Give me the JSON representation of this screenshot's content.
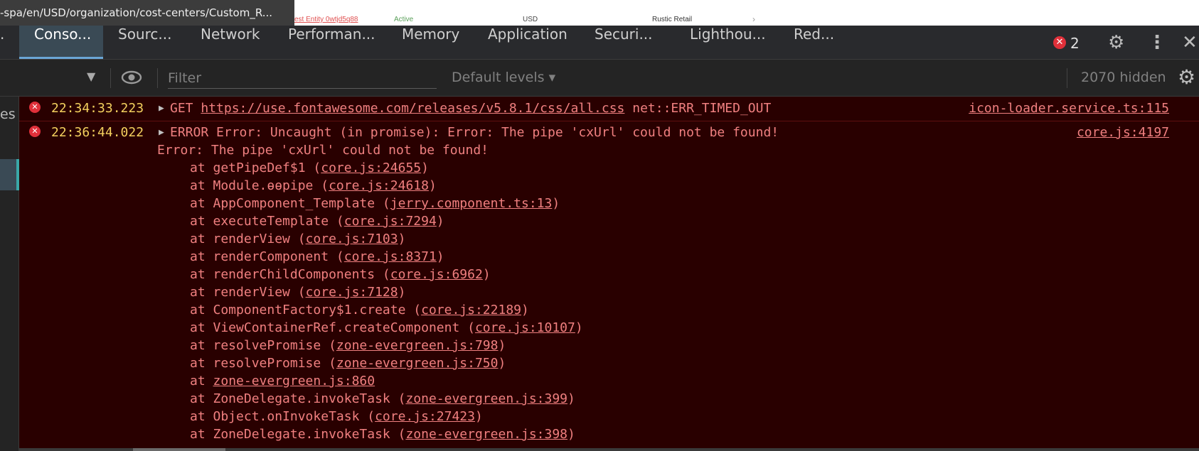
{
  "page": {
    "url_tooltip": "-spa/en/USD/organization/cost-centers/Custom_R...",
    "row": {
      "entity": "est Entity 0wtjd5q88",
      "status": "Active",
      "currency": "USD",
      "store": "Rustic Retail"
    }
  },
  "tabs": {
    "console": "Conso...",
    "sources": "Sourc...",
    "network": "Network",
    "performance": "Performan...",
    "memory": "Memory",
    "application": "Application",
    "security": "Securi...",
    "lighthouse": "Lighthou...",
    "redux": "Red..."
  },
  "toolbar": {
    "error_count": "2"
  },
  "filter": {
    "placeholder": "Filter",
    "levels": "Default levels",
    "hidden": "2070 hidden"
  },
  "sidebar": {
    "partial_text": "es"
  },
  "colors": {
    "error_bg": "#290000",
    "error_text": "#f08080",
    "timestamp": "#f3d05e",
    "accent": "#6aa6d6"
  },
  "messages": [
    {
      "time": "22:34:33.223",
      "method": "GET",
      "url": "https://use.fontawesome.com/releases/v5.8.1/css/all.css",
      "error": "net::ERR_TIMED_OUT",
      "source": "icon-loader.service.ts:115"
    },
    {
      "time": "22:36:44.022",
      "text": "ERROR Error: Uncaught (in promise): Error: The pipe 'cxUrl' could not be found!",
      "source": "core.js:4197",
      "detail": "Error: The pipe 'cxUrl' could not be found!",
      "stack": [
        {
          "fn": "at getPipeDef$1 (",
          "loc": "core.js:24655",
          "end": ")"
        },
        {
          "fn": "at Module.ɵɵpipe (",
          "loc": "core.js:24618",
          "end": ")"
        },
        {
          "fn": "at AppComponent_Template (",
          "loc": "jerry.component.ts:13",
          "end": ")"
        },
        {
          "fn": "at executeTemplate (",
          "loc": "core.js:7294",
          "end": ")"
        },
        {
          "fn": "at renderView (",
          "loc": "core.js:7103",
          "end": ")"
        },
        {
          "fn": "at renderComponent (",
          "loc": "core.js:8371",
          "end": ")"
        },
        {
          "fn": "at renderChildComponents (",
          "loc": "core.js:6962",
          "end": ")"
        },
        {
          "fn": "at renderView (",
          "loc": "core.js:7128",
          "end": ")"
        },
        {
          "fn": "at ComponentFactory$1.create (",
          "loc": "core.js:22189",
          "end": ")"
        },
        {
          "fn": "at ViewContainerRef.createComponent (",
          "loc": "core.js:10107",
          "end": ")"
        },
        {
          "fn": "at resolvePromise (",
          "loc": "zone-evergreen.js:798",
          "end": ")"
        },
        {
          "fn": "at resolvePromise (",
          "loc": "zone-evergreen.js:750",
          "end": ")"
        },
        {
          "fn": "at ",
          "loc": "zone-evergreen.js:860",
          "end": ""
        },
        {
          "fn": "at ZoneDelegate.invokeTask (",
          "loc": "zone-evergreen.js:399",
          "end": ")"
        },
        {
          "fn": "at Object.onInvokeTask (",
          "loc": "core.js:27423",
          "end": ")"
        },
        {
          "fn": "at ZoneDelegate.invokeTask (",
          "loc": "zone-evergreen.js:398",
          "end": ")"
        }
      ]
    }
  ]
}
